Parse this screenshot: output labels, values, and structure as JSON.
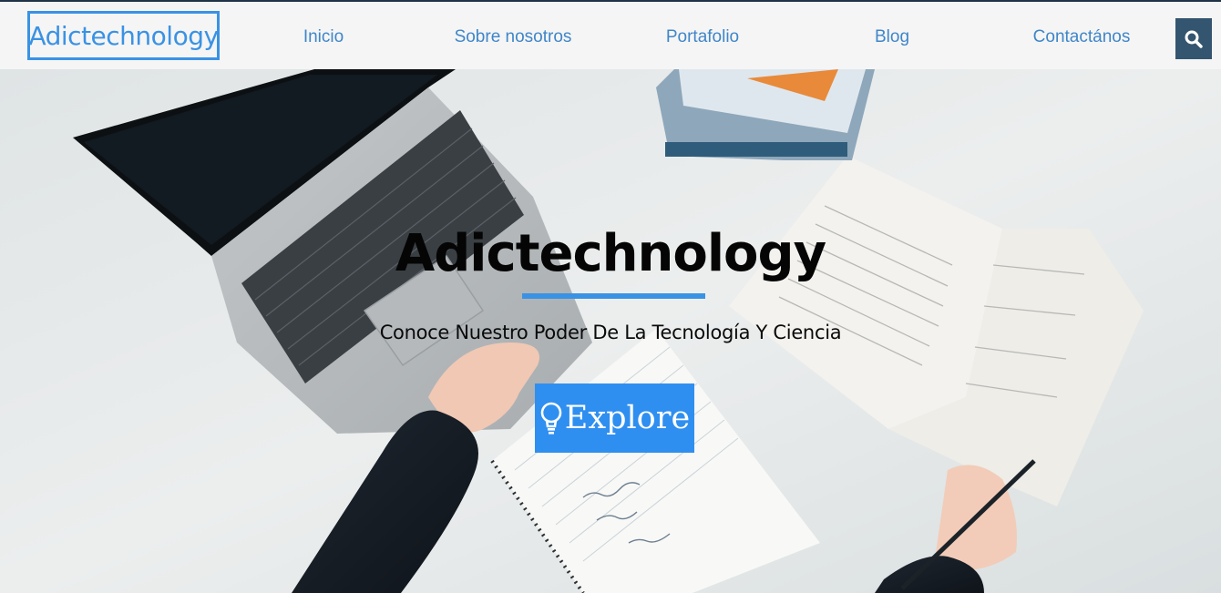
{
  "brand": {
    "name": "Adictechnology"
  },
  "nav": {
    "items": [
      {
        "label": "Inicio"
      },
      {
        "label": "Sobre nosotros"
      },
      {
        "label": "Portafolio"
      },
      {
        "label": "Blog"
      },
      {
        "label": "Contactános"
      }
    ],
    "search_icon": "search-icon"
  },
  "hero": {
    "title": "Adictechnology",
    "subtitle": "Conoce Nuestro Poder De La Tecnología Y Ciencia",
    "cta": {
      "label": "Explore",
      "icon": "lightbulb-icon"
    }
  },
  "colors": {
    "accent": "#3a92e4",
    "nav_link": "#3f86c9",
    "search_button": "#34556f",
    "cta_background": "#2f8ff0"
  }
}
